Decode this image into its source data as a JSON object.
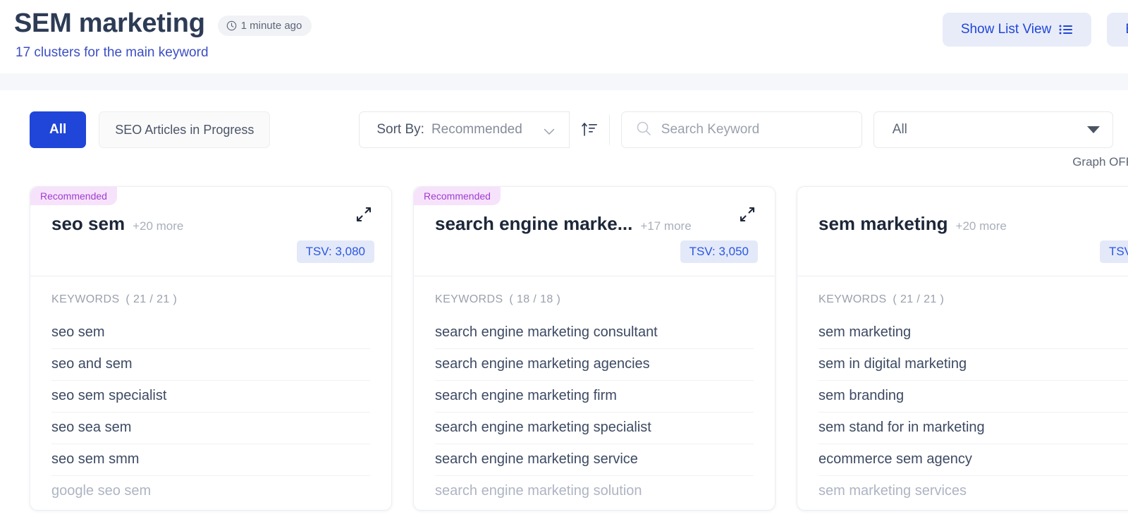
{
  "header": {
    "title": "SEM marketing",
    "timestamp": "1 minute ago",
    "clock_icon": "clock-icon",
    "subtitle": "17 clusters for the main keyword",
    "actions": [
      {
        "label": "Show List View",
        "icon": "list-icon"
      },
      {
        "label": "E",
        "icon": ""
      }
    ]
  },
  "toolbar": {
    "segment_all": "All",
    "segment_seo": "SEO Articles in Progress",
    "sort_label": "Sort By:",
    "sort_value": "Recommended",
    "sort_icon": "sort-descending-icon",
    "search_placeholder": "Search Keyword",
    "search_value": "",
    "search_icon": "search-icon",
    "filter_value": "All",
    "graph_toggle": "Graph OFF,"
  },
  "colors": {
    "accent_blue": "#1f46d8",
    "badge_purple_bg": "#f6e3fb",
    "badge_purple_text": "#a23bd0",
    "tsv_bg": "#e3e9f9",
    "tsv_text": "#2b56e0",
    "title_navy": "#2d3b55"
  },
  "cards": [
    {
      "badge": "Recommended",
      "title": "seo sem",
      "more": "+20 more",
      "tsv": "TSV: 3,080",
      "keywords_label": "KEYWORDS",
      "keywords_count": "( 21 / 21 )",
      "keywords": [
        "seo sem",
        "seo and sem",
        "seo sem specialist",
        "seo sea sem",
        "seo sem smm",
        "google seo sem"
      ]
    },
    {
      "badge": "Recommended",
      "title": "search engine marke...",
      "more": "+17 more",
      "tsv": "TSV: 3,050",
      "keywords_label": "KEYWORDS",
      "keywords_count": "( 18 / 18 )",
      "keywords": [
        "search engine marketing consultant",
        "search engine marketing agencies",
        "search engine marketing firm",
        "search engine marketing specialist",
        "search engine marketing service",
        "search engine marketing solution"
      ]
    },
    {
      "badge": "",
      "title": "sem marketing",
      "more": "+20 more",
      "tsv": "TSV",
      "keywords_label": "KEYWORDS",
      "keywords_count": "( 21 / 21 )",
      "keywords": [
        "sem marketing",
        "sem in digital marketing",
        "sem branding",
        "sem stand for in marketing",
        "ecommerce sem agency",
        "sem marketing services"
      ]
    }
  ]
}
